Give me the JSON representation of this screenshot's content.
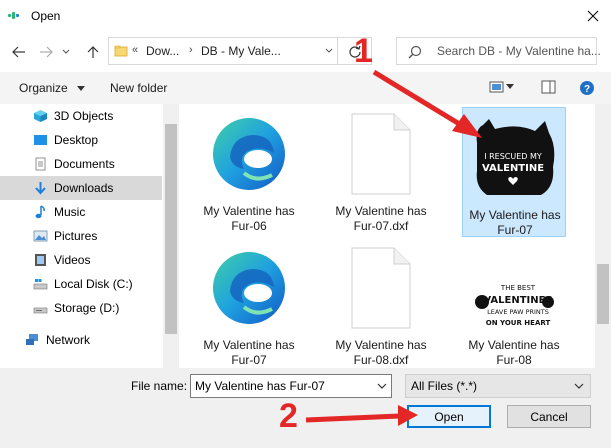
{
  "window": {
    "title": "Open"
  },
  "address": {
    "path_overflow": "«",
    "segments": [
      "Dow...",
      "DB - My Vale..."
    ]
  },
  "search": {
    "placeholder": "Search DB - My Valentine ha..."
  },
  "toolbar": {
    "organize_label": "Organize",
    "new_folder_label": "New folder"
  },
  "sidebar": {
    "items": [
      {
        "label": "3D Objects",
        "icon": "3d-objects-icon"
      },
      {
        "label": "Desktop",
        "icon": "desktop-icon"
      },
      {
        "label": "Documents",
        "icon": "documents-icon"
      },
      {
        "label": "Downloads",
        "icon": "downloads-icon",
        "selected": true
      },
      {
        "label": "Music",
        "icon": "music-icon"
      },
      {
        "label": "Pictures",
        "icon": "pictures-icon"
      },
      {
        "label": "Videos",
        "icon": "videos-icon"
      },
      {
        "label": "Local Disk (C:)",
        "icon": "local-disk-icon"
      },
      {
        "label": "Storage (D:)",
        "icon": "storage-drive-icon"
      },
      {
        "label": "Network",
        "icon": "network-icon"
      }
    ]
  },
  "files": [
    {
      "name_line1": "My Valentine has",
      "name_line2": "Fur-06",
      "type": "edge-icon"
    },
    {
      "name_line1": "My Valentine has",
      "name_line2": "Fur-07.dxf",
      "type": "blank-document-icon"
    },
    {
      "name_line1": "My Valentine has",
      "name_line2": "Fur-07",
      "type": "cat-design-thumbnail",
      "selected": true,
      "thumb_text_1": "I RESCUED MY",
      "thumb_text_2": "VALENTINE"
    },
    {
      "name_line1": "My Valentine has",
      "name_line2": "Fur-07",
      "type": "edge-icon"
    },
    {
      "name_line1": "My Valentine has",
      "name_line2": "Fur-08.dxf",
      "type": "blank-document-icon"
    },
    {
      "name_line1": "My Valentine has",
      "name_line2": "Fur-08",
      "type": "paw-design-thumbnail",
      "thumb_text_1": "THE BEST",
      "thumb_text_2": "VALENTINES",
      "thumb_text_3": "LEAVE PAW PRINTS",
      "thumb_text_4": "ON YOUR HEART"
    }
  ],
  "filename": {
    "label": "File name:",
    "value": "My Valentine has Fur-07"
  },
  "filter": {
    "value": "All Files (*.*)"
  },
  "buttons": {
    "open": "Open",
    "cancel": "Cancel"
  },
  "annotations": {
    "step1": "1",
    "step2": "2",
    "color": "#e32626"
  },
  "colors": {
    "selection": "#cce8ff",
    "accent": "#0078d7"
  }
}
